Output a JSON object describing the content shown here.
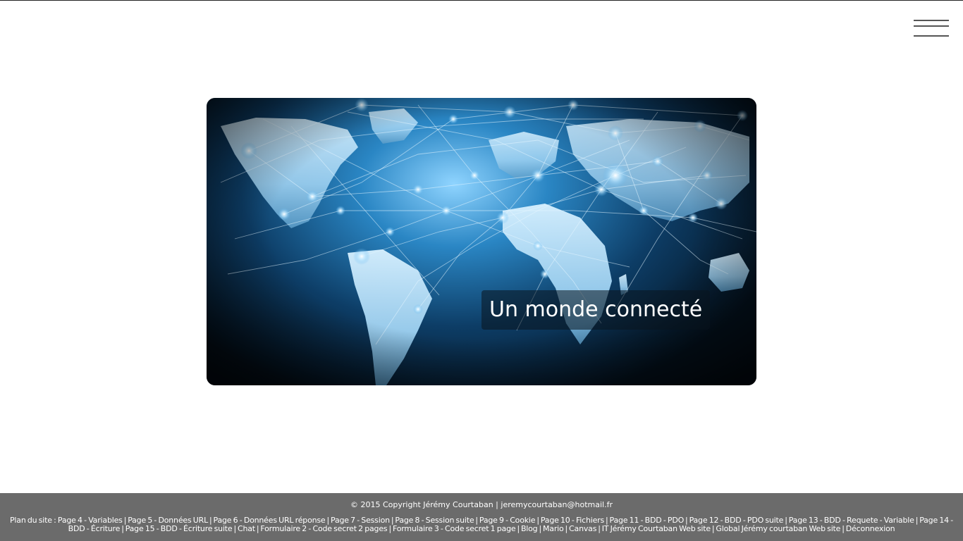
{
  "header": {
    "menu_icon": "hamburger-menu-icon"
  },
  "hero": {
    "image_icon": "world-network-map-image",
    "caption": "Un monde connecté"
  },
  "footer": {
    "copyright": "© 2015 Copyright Jérémy Courtaban | jeremycourtaban@hotmail.fr",
    "sitemap_prefix": "Plan du site :",
    "links": [
      "Page 4 - Variables",
      "Page 5 - Données URL",
      "Page 6 - Données URL réponse",
      "Page 7 - Session",
      "Page 8 - Session suite",
      "Page 9 - Cookie",
      "Page 10 - Fichiers",
      "Page 11 - BDD - PDO",
      "Page 12 - BDD - PDO suite",
      "Page 13 - BDD - Requete - Variable",
      "Page 14 - BDD - Écriture",
      "Page 15 - BDD - Écriture suite",
      "Chat",
      "Formulaire 2 - Code secret 2 pages",
      "Formulaire 3 - Code secret 1 page",
      "Blog",
      "Mario",
      "Canvas",
      "IT Jérémy Courtaban Web site",
      "Global Jérémy courtaban Web site",
      "Déconnexion"
    ]
  }
}
